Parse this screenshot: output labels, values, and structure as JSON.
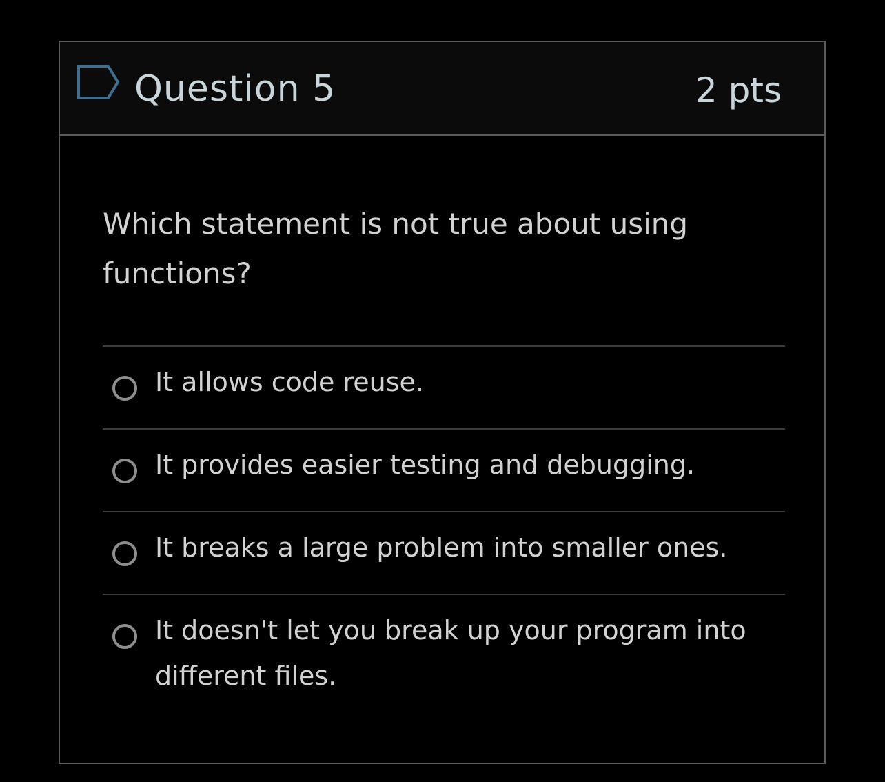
{
  "question": {
    "title": "Question 5",
    "points": "2 pts",
    "flag_icon": "flag-outline-icon",
    "text": "Which statement is not true about using functions?"
  },
  "answers": [
    {
      "label": "It allows code reuse.",
      "selected": false
    },
    {
      "label": "It provides easier testing and debugging.",
      "selected": false
    },
    {
      "label": "It breaks a large problem into smaller ones.",
      "selected": false
    },
    {
      "label": "It doesn't let you break up your program into different files.",
      "selected": false
    }
  ],
  "colors": {
    "background": "#000000",
    "header_background": "#0b0b0b",
    "border": "#5a5a5a",
    "title_text": "#c9d4db",
    "body_text": "#d2d2d2",
    "flag_accent": "#3f6f8f",
    "radio_border": "#8e8e8e"
  }
}
